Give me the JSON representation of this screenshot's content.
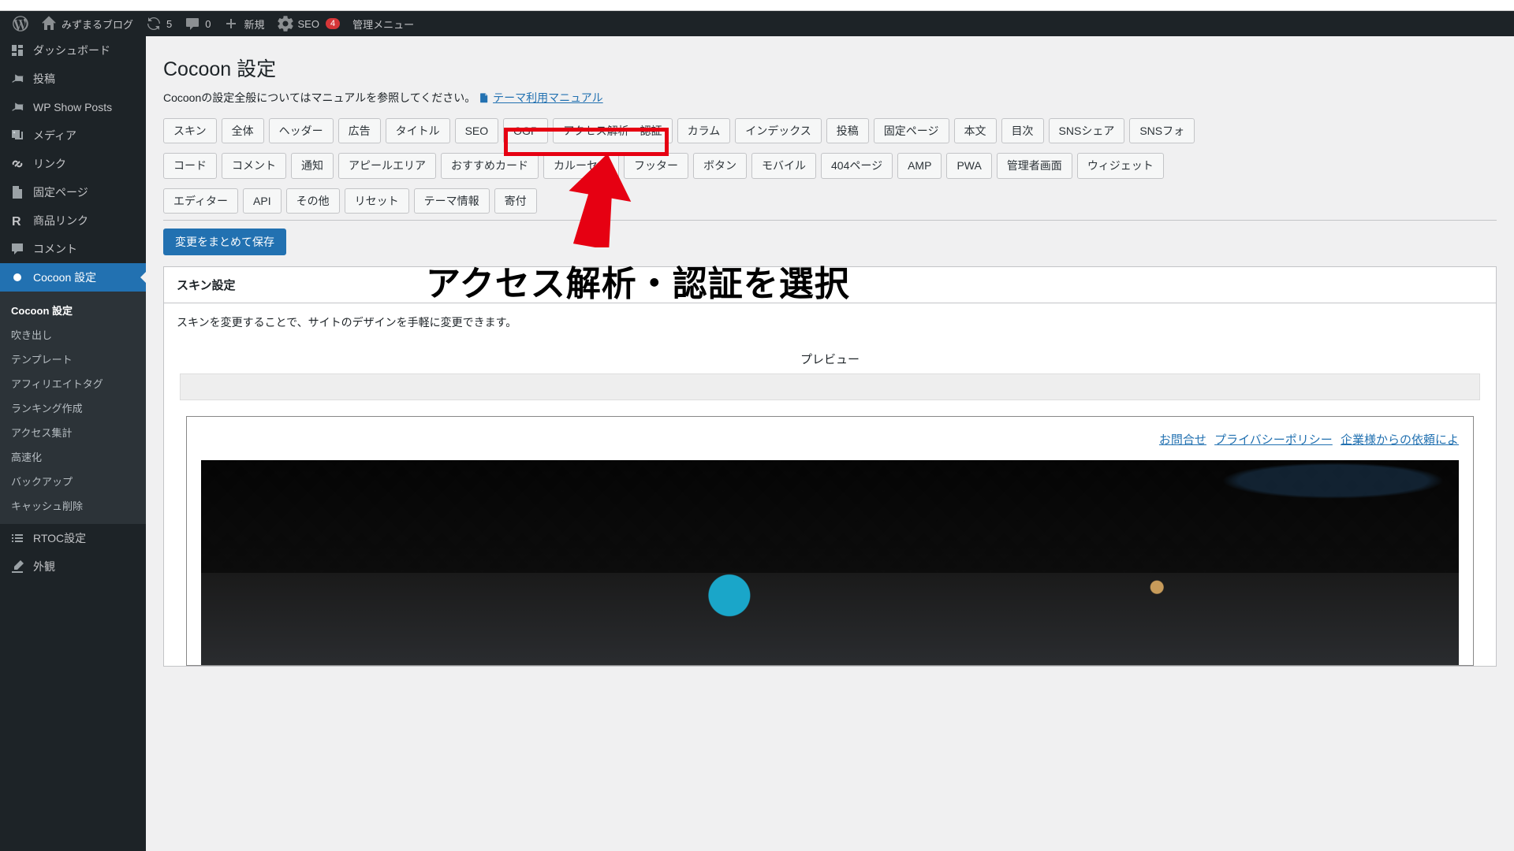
{
  "adminbar": {
    "site_name": "みずまるブログ",
    "updates_count": "5",
    "comments_count": "0",
    "new_label": "新規",
    "seo_label": "SEO",
    "seo_badge": "4",
    "admin_menu_label": "管理メニュー"
  },
  "sidebar": {
    "items": [
      {
        "label": "ダッシュボード",
        "icon": "dashboard"
      },
      {
        "label": "投稿",
        "icon": "pin"
      },
      {
        "label": "WP Show Posts",
        "icon": "pin"
      },
      {
        "label": "メディア",
        "icon": "media"
      },
      {
        "label": "リンク",
        "icon": "link"
      },
      {
        "label": "固定ページ",
        "icon": "page"
      },
      {
        "label": "商品リンク",
        "icon": "r"
      },
      {
        "label": "コメント",
        "icon": "comment"
      },
      {
        "label": "Cocoon 設定",
        "icon": "dot",
        "current": true
      },
      {
        "label": "RTOC設定",
        "icon": "list"
      },
      {
        "label": "外観",
        "icon": "brush"
      }
    ],
    "submenu": [
      "Cocoon 設定",
      "吹き出し",
      "テンプレート",
      "アフィリエイトタグ",
      "ランキング作成",
      "アクセス集計",
      "高速化",
      "バックアップ",
      "キャッシュ削除"
    ]
  },
  "page": {
    "title": "Cocoon 設定",
    "help_text_prefix": "Cocoonの設定全般についてはマニュアルを参照してください。",
    "manual_link": "テーマ利用マニュアル"
  },
  "tabs": {
    "row1": [
      "スキン",
      "全体",
      "ヘッダー",
      "広告",
      "タイトル",
      "SEO",
      "OGP",
      "アクセス解析・認証",
      "カラム",
      "インデックス",
      "投稿",
      "固定ページ",
      "本文",
      "目次",
      "SNSシェア",
      "SNSフォ"
    ],
    "row2": [
      "コード",
      "コメント",
      "通知",
      "アピールエリア",
      "おすすめカード",
      "カルーセル",
      "フッター",
      "ボタン",
      "モバイル",
      "404ページ",
      "AMP",
      "PWA",
      "管理者画面",
      "ウィジェット"
    ],
    "row3": [
      "エディター",
      "API",
      "その他",
      "リセット",
      "テーマ情報",
      "寄付"
    ]
  },
  "save_button": "変更をまとめて保存",
  "section": {
    "title": "スキン設定",
    "desc": "スキンを変更することで、サイトのデザインを手軽に変更できます。",
    "preview_label": "プレビュー",
    "links": [
      "お問合せ",
      "プライバシーポリシー",
      "企業様からの依頼によ"
    ]
  },
  "annotation": {
    "text": "アクセス解析・認証を選択"
  }
}
